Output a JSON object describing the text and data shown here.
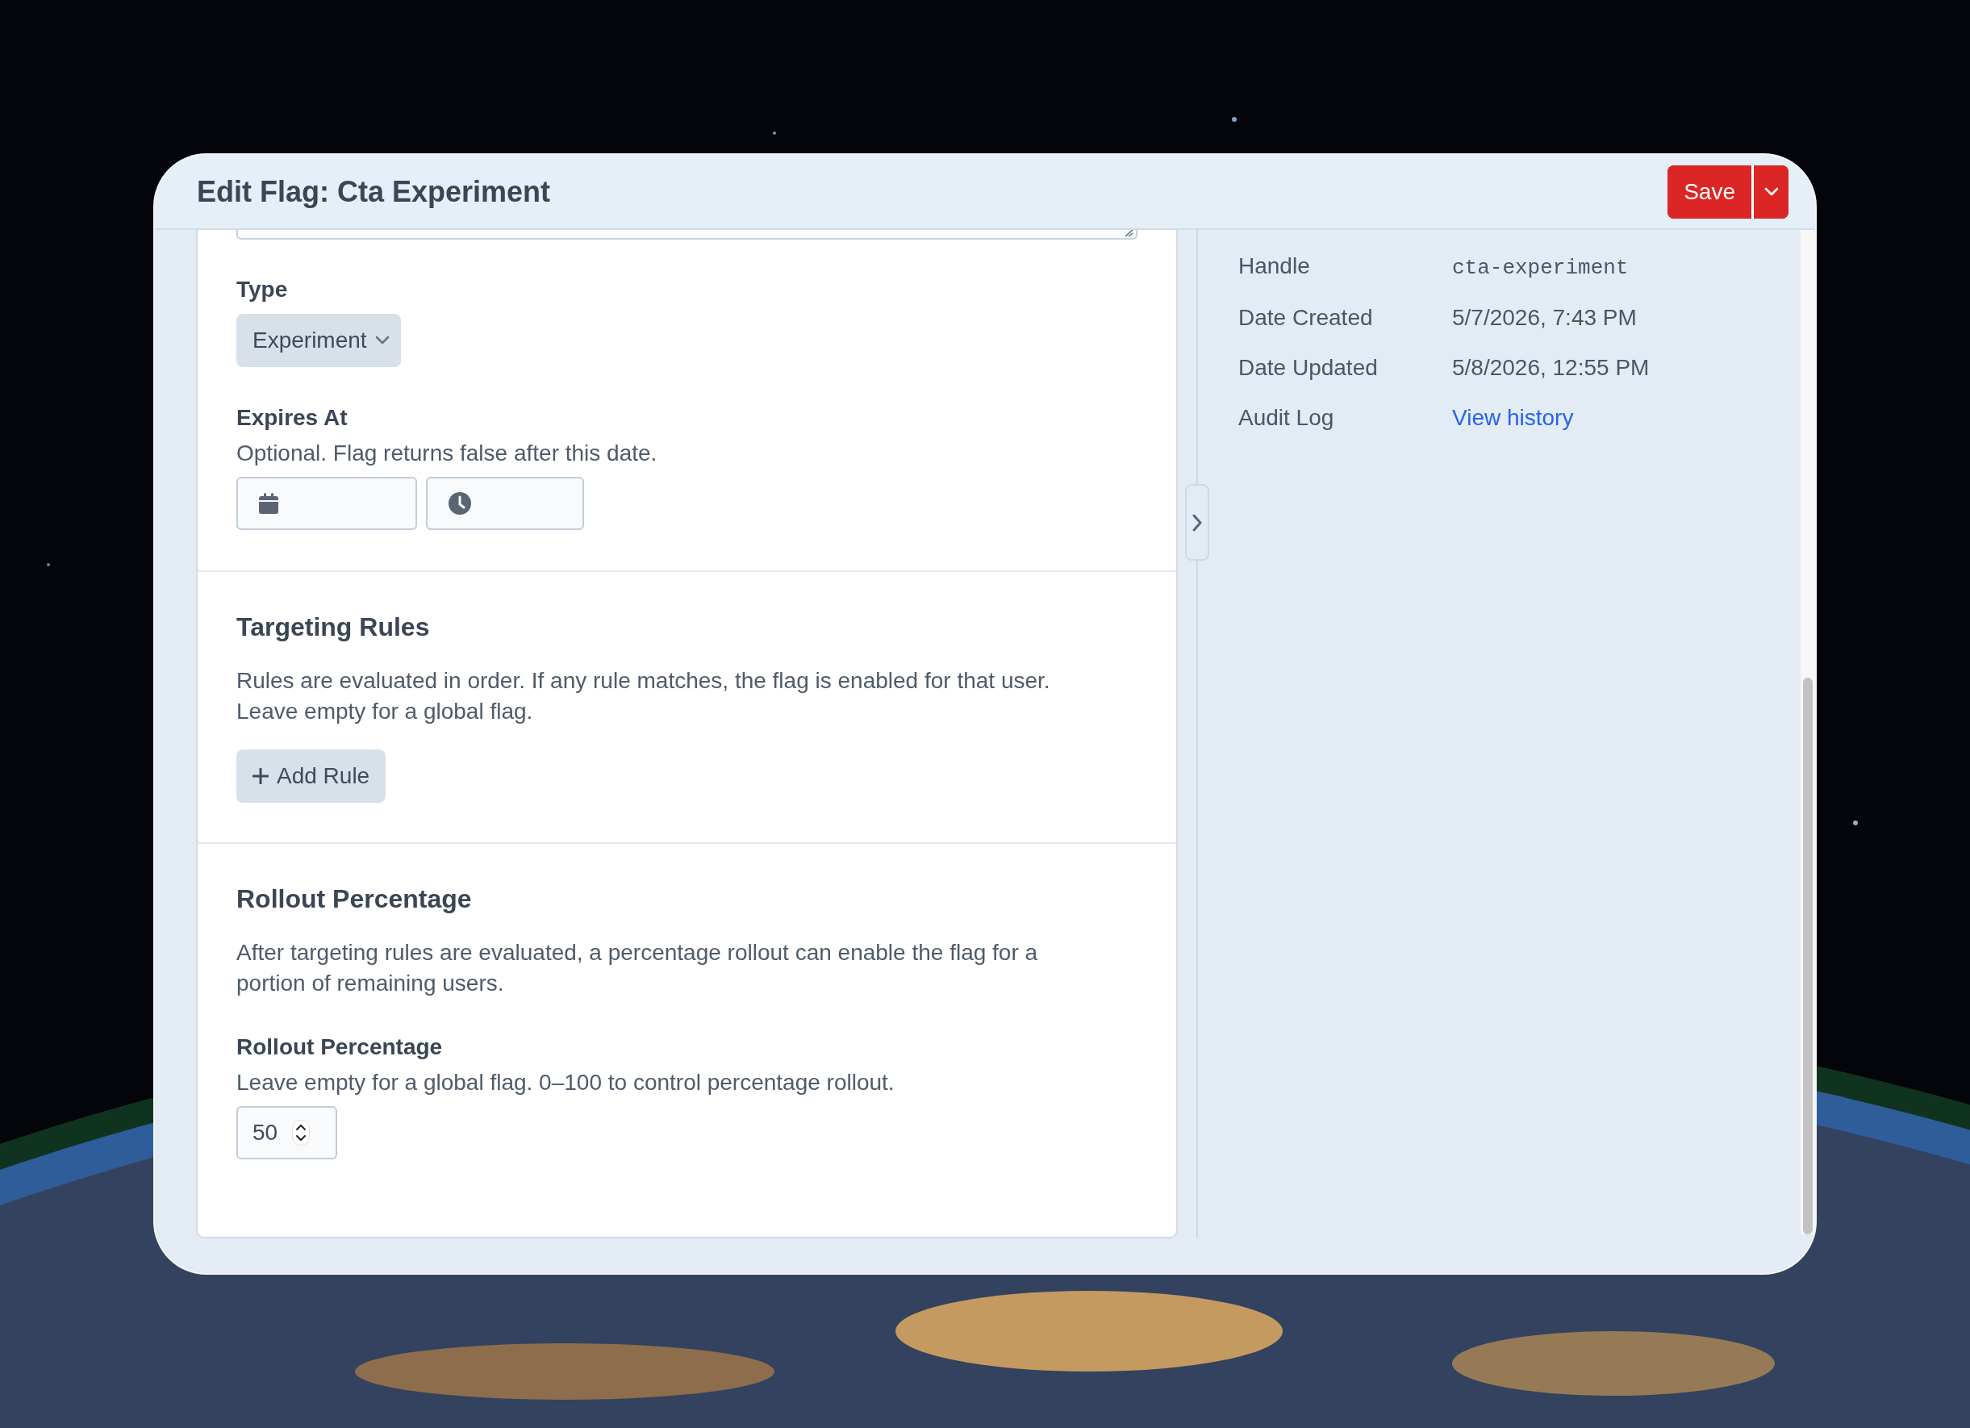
{
  "dialog": {
    "title": "Edit Flag: Cta Experiment",
    "save_button": "Save"
  },
  "form": {
    "type": {
      "label": "Type",
      "value": "Experiment"
    },
    "expires": {
      "label": "Expires At",
      "help": "Optional. Flag returns false after this date."
    },
    "sections": [
      {
        "kind": "rules",
        "heading": "Targeting Rules",
        "description": "Rules are evaluated in order. If any rule matches, the flag is enabled for that user. Leave empty for a global flag.",
        "button": "Add Rule"
      },
      {
        "kind": "rollout",
        "heading": "Rollout Percentage",
        "description": "After targeting rules are evaluated, a percentage rollout can enable the flag for a portion of remaining users.",
        "field": {
          "label": "Rollout Percentage",
          "help": "Leave empty for a global flag. 0–100 to control percentage rollout.",
          "value": "50"
        }
      }
    ]
  },
  "details": [
    {
      "kind": "code",
      "label": "Handle",
      "value": "cta-experiment"
    },
    {
      "kind": "text",
      "label": "Date Created",
      "value": "5/7/2026, 7:43 PM"
    },
    {
      "kind": "text",
      "label": "Date Updated",
      "value": "5/8/2026, 12:55 PM"
    },
    {
      "kind": "link",
      "label": "Audit Log",
      "value": "View history"
    }
  ]
}
